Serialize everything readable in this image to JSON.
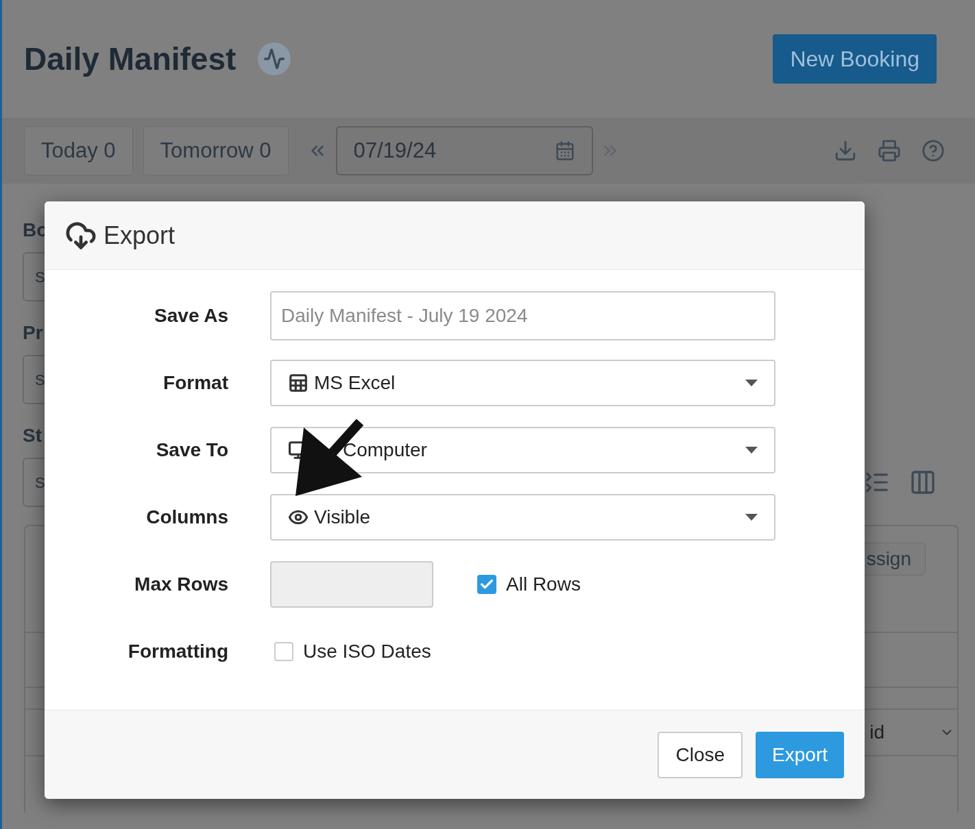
{
  "page": {
    "title": "Daily Manifest",
    "new_booking": "New Booking"
  },
  "toolbar": {
    "buttons": [
      "Today 0",
      "Tomorrow 0"
    ],
    "date": "07/19/24"
  },
  "background_form": [
    {
      "label": "Bo",
      "field": "S"
    },
    {
      "label": "Pr",
      "field": "S"
    },
    {
      "label": "St",
      "field": "S"
    }
  ],
  "background_panel": {
    "button": "ssign",
    "select": "id"
  },
  "modal": {
    "title": "Export",
    "rows": [
      {
        "label": "Save As",
        "kind": "text",
        "placeholder": "Daily Manifest - July 19 2024"
      },
      {
        "label": "Format",
        "kind": "select",
        "value": "MS Excel"
      },
      {
        "label": "Save To",
        "kind": "select",
        "value": "Computer"
      },
      {
        "label": "Columns",
        "kind": "select",
        "value": "Visible"
      },
      {
        "label": "Max Rows",
        "kind": "limit",
        "disabled": true,
        "checkbox": {
          "label": "All Rows",
          "checked": true
        }
      },
      {
        "label": "Formatting",
        "kind": "checkbox",
        "checkbox": {
          "label": "Use ISO Dates",
          "checked": false
        }
      }
    ],
    "buttons": [
      {
        "label": "Close",
        "primary": false
      },
      {
        "label": "Export",
        "primary": true
      }
    ]
  }
}
